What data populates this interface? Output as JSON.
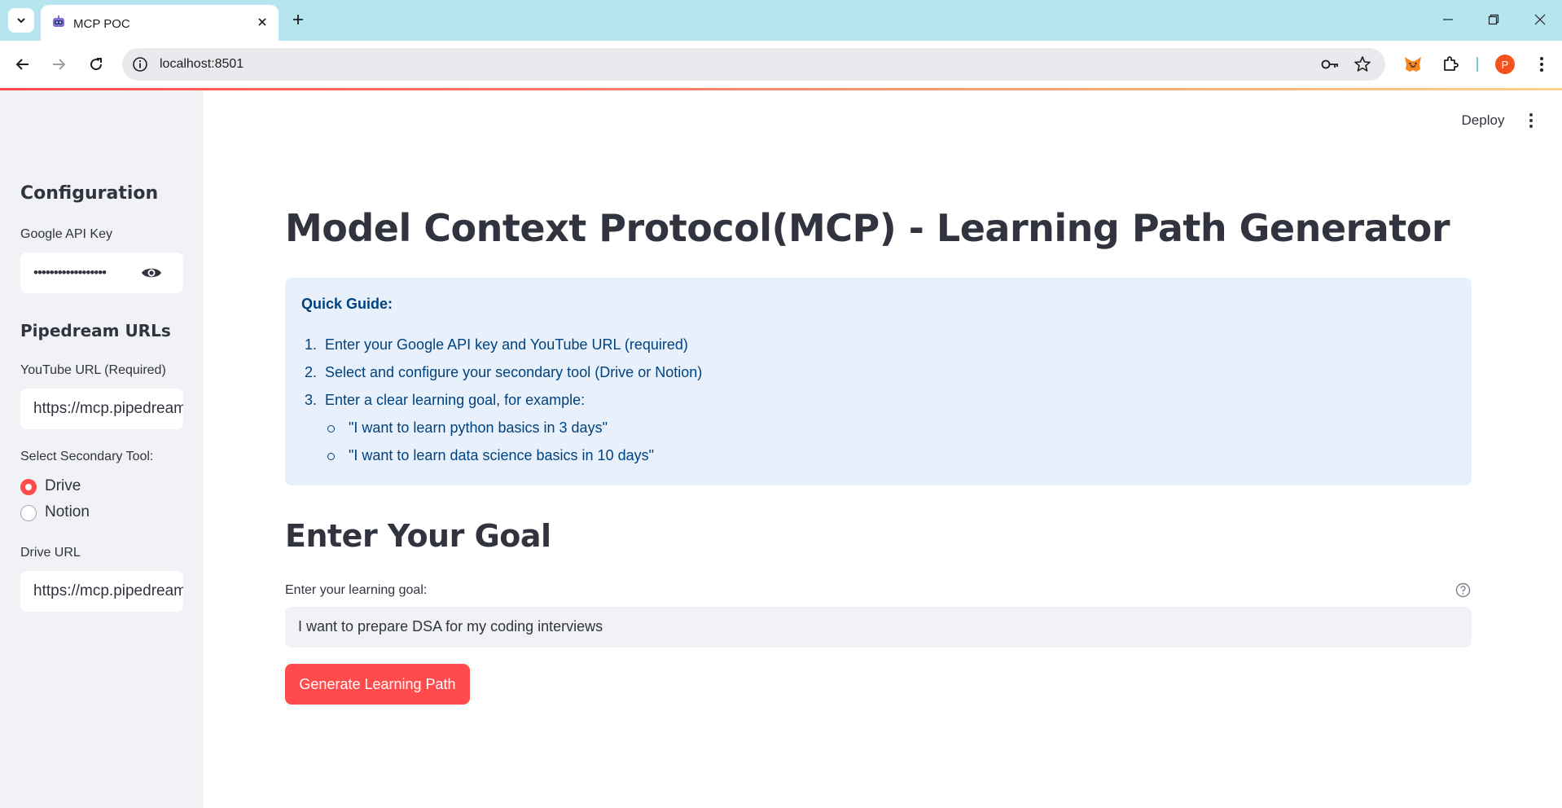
{
  "browser": {
    "tab_title": "MCP POC",
    "url": "localhost:8501",
    "profile_initial": "P"
  },
  "header": {
    "deploy_label": "Deploy"
  },
  "sidebar": {
    "configuration_heading": "Configuration",
    "api_key_label": "Google API Key",
    "api_key_value": "••••••••••••••••••",
    "pipedream_heading": "Pipedream URLs",
    "youtube_label": "YouTube URL (Required)",
    "youtube_value": "https://mcp.pipedream",
    "secondary_tool_label": "Select Secondary Tool:",
    "tool_options": [
      "Drive",
      "Notion"
    ],
    "selected_tool": "Drive",
    "drive_url_label": "Drive URL",
    "drive_url_value": "https://mcp.pipedream"
  },
  "main": {
    "title": "Model Context Protocol(MCP) - Learning Path Generator",
    "guide": {
      "title": "Quick Guide:",
      "steps": [
        "Enter your Google API key and YouTube URL (required)",
        "Select and configure your secondary tool (Drive or Notion)",
        "Enter a clear learning goal, for example:"
      ],
      "examples": [
        "\"I want to learn python basics in 3 days\"",
        "\"I want to learn data science basics in 10 days\""
      ]
    },
    "goal_heading": "Enter Your Goal",
    "goal_label": "Enter your learning goal:",
    "goal_value": "I want to prepare DSA for my coding interviews",
    "generate_label": "Generate Learning Path"
  },
  "colors": {
    "primary": "#ff4b4b",
    "sidebar_bg": "#f0f2f6",
    "info_bg": "#e7f0fb",
    "info_text": "#004280",
    "tabbar_bg": "#b6e4ef"
  }
}
